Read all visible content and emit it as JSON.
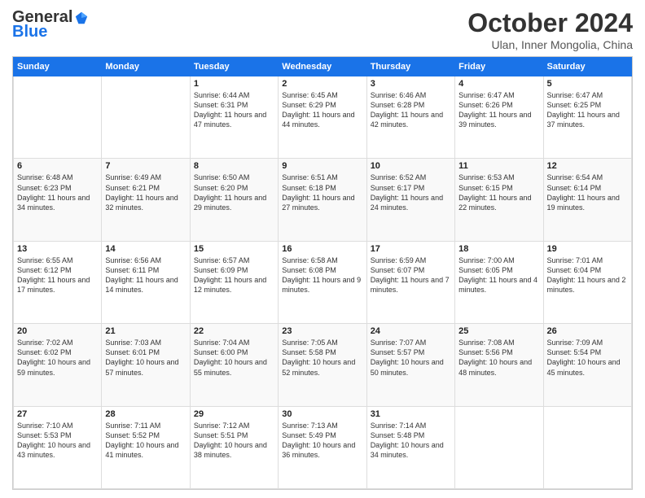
{
  "header": {
    "logo_line1": "General",
    "logo_line2": "Blue",
    "title": "October 2024",
    "subtitle": "Ulan, Inner Mongolia, China"
  },
  "days_of_week": [
    "Sunday",
    "Monday",
    "Tuesday",
    "Wednesday",
    "Thursday",
    "Friday",
    "Saturday"
  ],
  "weeks": [
    [
      {
        "day": "",
        "sunrise": "",
        "sunset": "",
        "daylight": ""
      },
      {
        "day": "",
        "sunrise": "",
        "sunset": "",
        "daylight": ""
      },
      {
        "day": "1",
        "sunrise": "Sunrise: 6:44 AM",
        "sunset": "Sunset: 6:31 PM",
        "daylight": "Daylight: 11 hours and 47 minutes."
      },
      {
        "day": "2",
        "sunrise": "Sunrise: 6:45 AM",
        "sunset": "Sunset: 6:29 PM",
        "daylight": "Daylight: 11 hours and 44 minutes."
      },
      {
        "day": "3",
        "sunrise": "Sunrise: 6:46 AM",
        "sunset": "Sunset: 6:28 PM",
        "daylight": "Daylight: 11 hours and 42 minutes."
      },
      {
        "day": "4",
        "sunrise": "Sunrise: 6:47 AM",
        "sunset": "Sunset: 6:26 PM",
        "daylight": "Daylight: 11 hours and 39 minutes."
      },
      {
        "day": "5",
        "sunrise": "Sunrise: 6:47 AM",
        "sunset": "Sunset: 6:25 PM",
        "daylight": "Daylight: 11 hours and 37 minutes."
      }
    ],
    [
      {
        "day": "6",
        "sunrise": "Sunrise: 6:48 AM",
        "sunset": "Sunset: 6:23 PM",
        "daylight": "Daylight: 11 hours and 34 minutes."
      },
      {
        "day": "7",
        "sunrise": "Sunrise: 6:49 AM",
        "sunset": "Sunset: 6:21 PM",
        "daylight": "Daylight: 11 hours and 32 minutes."
      },
      {
        "day": "8",
        "sunrise": "Sunrise: 6:50 AM",
        "sunset": "Sunset: 6:20 PM",
        "daylight": "Daylight: 11 hours and 29 minutes."
      },
      {
        "day": "9",
        "sunrise": "Sunrise: 6:51 AM",
        "sunset": "Sunset: 6:18 PM",
        "daylight": "Daylight: 11 hours and 27 minutes."
      },
      {
        "day": "10",
        "sunrise": "Sunrise: 6:52 AM",
        "sunset": "Sunset: 6:17 PM",
        "daylight": "Daylight: 11 hours and 24 minutes."
      },
      {
        "day": "11",
        "sunrise": "Sunrise: 6:53 AM",
        "sunset": "Sunset: 6:15 PM",
        "daylight": "Daylight: 11 hours and 22 minutes."
      },
      {
        "day": "12",
        "sunrise": "Sunrise: 6:54 AM",
        "sunset": "Sunset: 6:14 PM",
        "daylight": "Daylight: 11 hours and 19 minutes."
      }
    ],
    [
      {
        "day": "13",
        "sunrise": "Sunrise: 6:55 AM",
        "sunset": "Sunset: 6:12 PM",
        "daylight": "Daylight: 11 hours and 17 minutes."
      },
      {
        "day": "14",
        "sunrise": "Sunrise: 6:56 AM",
        "sunset": "Sunset: 6:11 PM",
        "daylight": "Daylight: 11 hours and 14 minutes."
      },
      {
        "day": "15",
        "sunrise": "Sunrise: 6:57 AM",
        "sunset": "Sunset: 6:09 PM",
        "daylight": "Daylight: 11 hours and 12 minutes."
      },
      {
        "day": "16",
        "sunrise": "Sunrise: 6:58 AM",
        "sunset": "Sunset: 6:08 PM",
        "daylight": "Daylight: 11 hours and 9 minutes."
      },
      {
        "day": "17",
        "sunrise": "Sunrise: 6:59 AM",
        "sunset": "Sunset: 6:07 PM",
        "daylight": "Daylight: 11 hours and 7 minutes."
      },
      {
        "day": "18",
        "sunrise": "Sunrise: 7:00 AM",
        "sunset": "Sunset: 6:05 PM",
        "daylight": "Daylight: 11 hours and 4 minutes."
      },
      {
        "day": "19",
        "sunrise": "Sunrise: 7:01 AM",
        "sunset": "Sunset: 6:04 PM",
        "daylight": "Daylight: 11 hours and 2 minutes."
      }
    ],
    [
      {
        "day": "20",
        "sunrise": "Sunrise: 7:02 AM",
        "sunset": "Sunset: 6:02 PM",
        "daylight": "Daylight: 10 hours and 59 minutes."
      },
      {
        "day": "21",
        "sunrise": "Sunrise: 7:03 AM",
        "sunset": "Sunset: 6:01 PM",
        "daylight": "Daylight: 10 hours and 57 minutes."
      },
      {
        "day": "22",
        "sunrise": "Sunrise: 7:04 AM",
        "sunset": "Sunset: 6:00 PM",
        "daylight": "Daylight: 10 hours and 55 minutes."
      },
      {
        "day": "23",
        "sunrise": "Sunrise: 7:05 AM",
        "sunset": "Sunset: 5:58 PM",
        "daylight": "Daylight: 10 hours and 52 minutes."
      },
      {
        "day": "24",
        "sunrise": "Sunrise: 7:07 AM",
        "sunset": "Sunset: 5:57 PM",
        "daylight": "Daylight: 10 hours and 50 minutes."
      },
      {
        "day": "25",
        "sunrise": "Sunrise: 7:08 AM",
        "sunset": "Sunset: 5:56 PM",
        "daylight": "Daylight: 10 hours and 48 minutes."
      },
      {
        "day": "26",
        "sunrise": "Sunrise: 7:09 AM",
        "sunset": "Sunset: 5:54 PM",
        "daylight": "Daylight: 10 hours and 45 minutes."
      }
    ],
    [
      {
        "day": "27",
        "sunrise": "Sunrise: 7:10 AM",
        "sunset": "Sunset: 5:53 PM",
        "daylight": "Daylight: 10 hours and 43 minutes."
      },
      {
        "day": "28",
        "sunrise": "Sunrise: 7:11 AM",
        "sunset": "Sunset: 5:52 PM",
        "daylight": "Daylight: 10 hours and 41 minutes."
      },
      {
        "day": "29",
        "sunrise": "Sunrise: 7:12 AM",
        "sunset": "Sunset: 5:51 PM",
        "daylight": "Daylight: 10 hours and 38 minutes."
      },
      {
        "day": "30",
        "sunrise": "Sunrise: 7:13 AM",
        "sunset": "Sunset: 5:49 PM",
        "daylight": "Daylight: 10 hours and 36 minutes."
      },
      {
        "day": "31",
        "sunrise": "Sunrise: 7:14 AM",
        "sunset": "Sunset: 5:48 PM",
        "daylight": "Daylight: 10 hours and 34 minutes."
      },
      {
        "day": "",
        "sunrise": "",
        "sunset": "",
        "daylight": ""
      },
      {
        "day": "",
        "sunrise": "",
        "sunset": "",
        "daylight": ""
      }
    ]
  ]
}
